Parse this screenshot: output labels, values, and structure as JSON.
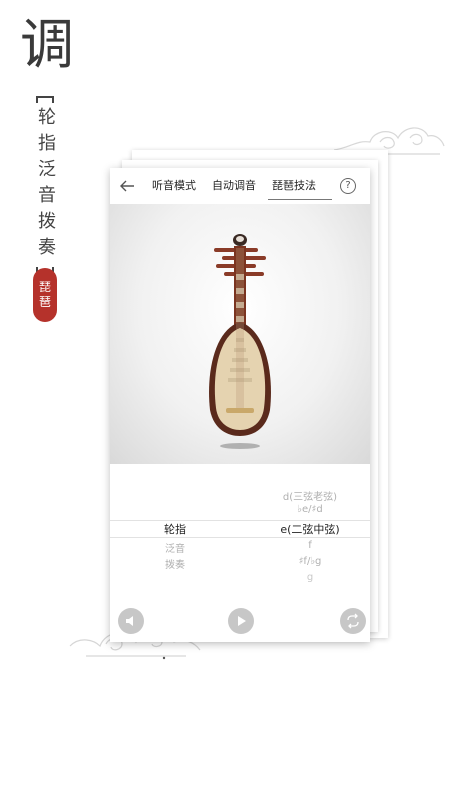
{
  "page": {
    "title_char": "调",
    "vertical_subtitle": "轮指泛音拨奏",
    "seal_text": [
      "琵",
      "琶"
    ]
  },
  "nav": {
    "back_icon": "arrow-left-icon",
    "tabs": [
      {
        "label": "听音模式",
        "active": false
      },
      {
        "label": "自动调音",
        "active": false
      },
      {
        "label": "琵琶技法",
        "active": true
      }
    ],
    "help_icon": "question-circle-icon",
    "help_label": "?"
  },
  "technique_table": {
    "left_column": [
      "轮指",
      "泛音",
      "拨奏"
    ],
    "right_column": [
      "d(三弦老弦)",
      "♭e/♯d",
      "e(二弦中弦)",
      "f",
      "♯f/♭g",
      "g"
    ],
    "selected_index": 0
  },
  "controls": {
    "left_icon": "sound-icon",
    "play_icon": "play-icon",
    "right_icon": "repeat-icon"
  },
  "colors": {
    "seal": "#b5322b",
    "instrument_body": "#e5d3b0",
    "instrument_frame": "#5a2a1c"
  }
}
